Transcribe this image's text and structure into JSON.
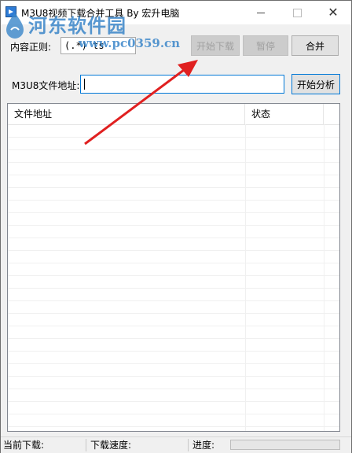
{
  "window": {
    "title": "M3U8视频下载合并工具 By 宏升电脑"
  },
  "watermark": {
    "text": "河东软件园",
    "url": "www.pc0359.cn"
  },
  "regex": {
    "label": "内容正则:",
    "value": "(.*) ts"
  },
  "toolbar": {
    "start_download": "开始下载",
    "pause": "暂停",
    "merge": "合并"
  },
  "source": {
    "label": "M3U8文件地址:",
    "value": "",
    "analyze": "开始分析"
  },
  "list": {
    "columns": [
      "文件地址",
      "状态"
    ],
    "rows": []
  },
  "status": {
    "current_label": "当前下载:",
    "speed_label": "下载速度:",
    "progress_label": "进度:",
    "progress_value": 0
  },
  "colors": {
    "accent": "#0078d7",
    "annotation_arrow": "#e02020",
    "watermark": "#3a86c9"
  }
}
